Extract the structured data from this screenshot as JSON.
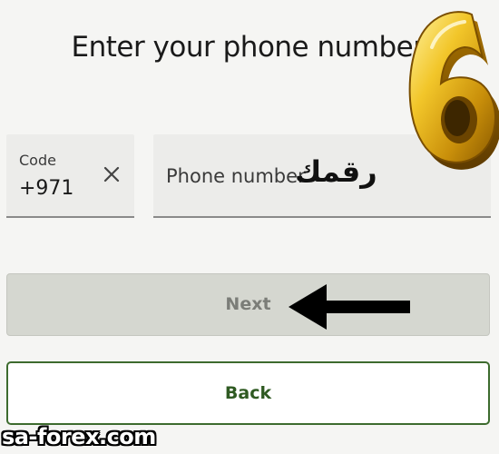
{
  "header": {
    "title": "Enter your phone number"
  },
  "code_field": {
    "label": "Code",
    "value": "+971"
  },
  "phone_field": {
    "placeholder": "Phone number"
  },
  "annotation": {
    "arabic_text": "رقمك",
    "step_number": "6"
  },
  "buttons": {
    "next_label": "Next",
    "back_label": "Back"
  },
  "watermark": {
    "text": "sa-forex.com"
  },
  "colors": {
    "background": "#f5f5f3",
    "field_background": "#ececea",
    "next_disabled": "#d5d7d0",
    "back_border": "#3d6b2e",
    "back_text": "#2f5a22",
    "badge_gold": "#e0b21a"
  }
}
